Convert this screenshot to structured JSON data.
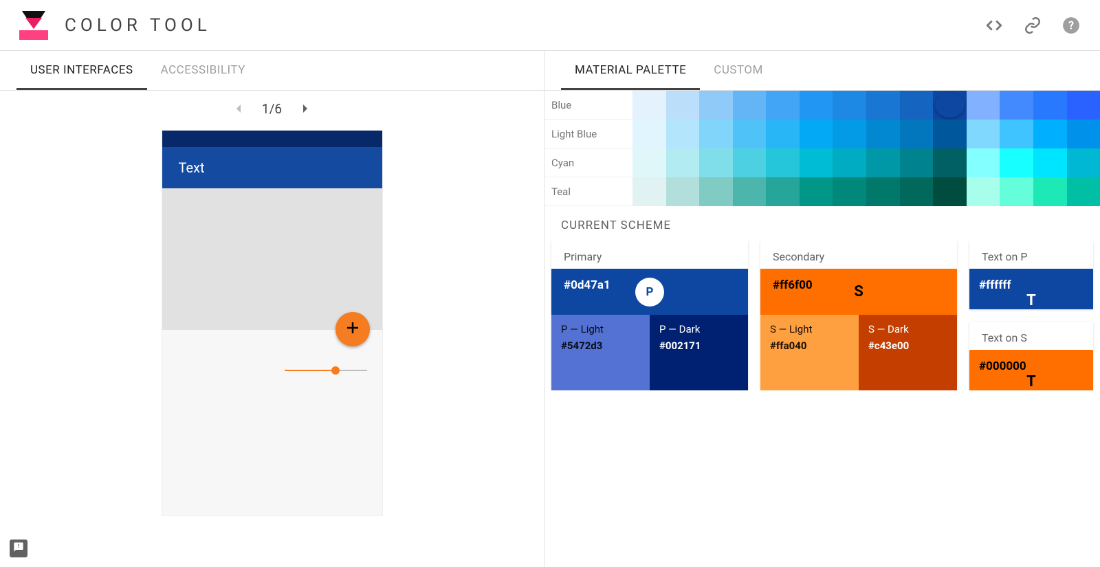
{
  "header": {
    "title": "COLOR TOOL"
  },
  "tabs": {
    "ui": "USER INTERFACES",
    "a11y": "ACCESSIBILITY"
  },
  "pager": {
    "count": "1/6"
  },
  "preview": {
    "appbar_text": "Text"
  },
  "rtabs": {
    "material": "MATERIAL PALETTE",
    "custom": "CUSTOM"
  },
  "palette_rows": [
    {
      "name": "Blue",
      "colors": [
        "#e3f2fd",
        "#bbdefb",
        "#90caf9",
        "#64b5f6",
        "#42a5f5",
        "#2196f3",
        "#1e88e5",
        "#1976d2",
        "#1565c0",
        "#0d47a1",
        "#82b1ff",
        "#448aff",
        "#2979ff",
        "#2962ff"
      ],
      "selected": 9
    },
    {
      "name": "Light Blue",
      "colors": [
        "#e1f5fe",
        "#b3e5fc",
        "#81d4fa",
        "#4fc3f7",
        "#29b6f6",
        "#03a9f4",
        "#039be5",
        "#0288d1",
        "#0277bd",
        "#01579b",
        "#80d8ff",
        "#40c4ff",
        "#00b0ff",
        "#0091ea"
      ],
      "selected": -1
    },
    {
      "name": "Cyan",
      "colors": [
        "#e0f7fa",
        "#b2ebf2",
        "#80deea",
        "#4dd0e1",
        "#26c6da",
        "#00bcd4",
        "#00acc1",
        "#0097a7",
        "#00838f",
        "#006064",
        "#84ffff",
        "#18ffff",
        "#00e5ff",
        "#00b8d4"
      ],
      "selected": -1
    },
    {
      "name": "Teal",
      "colors": [
        "#e0f2f1",
        "#b2dfdb",
        "#80cbc4",
        "#4db6ac",
        "#26a69a",
        "#009688",
        "#00897b",
        "#00796b",
        "#00695c",
        "#004d40",
        "#a7ffeb",
        "#64ffda",
        "#1de9b6",
        "#00bfa5"
      ],
      "selected": -1
    }
  ],
  "scheme": {
    "title": "CURRENT SCHEME",
    "primary": {
      "label": "Primary",
      "hex": "#0d47a1",
      "badge": "P",
      "light_label": "P — Light",
      "light_hex": "#5472d3",
      "dark_label": "P — Dark",
      "dark_hex": "#002171",
      "light_bg": "#5472d3",
      "dark_bg": "#002171"
    },
    "secondary": {
      "label": "Secondary",
      "hex": "#ff6f00",
      "badge": "S",
      "light_label": "S — Light",
      "light_hex": "#ffa040",
      "dark_label": "S — Dark",
      "dark_hex": "#c43e00",
      "light_bg": "#ffa040",
      "dark_bg": "#c43e00"
    },
    "text_p": {
      "label": "Text on P",
      "hex": "#ffffff",
      "letter": "T",
      "bg": "#0d47a1",
      "fg": "#ffffff"
    },
    "text_s": {
      "label": "Text on S",
      "hex": "#000000",
      "letter": "T",
      "bg": "#ff6f00",
      "fg": "#000000"
    }
  }
}
